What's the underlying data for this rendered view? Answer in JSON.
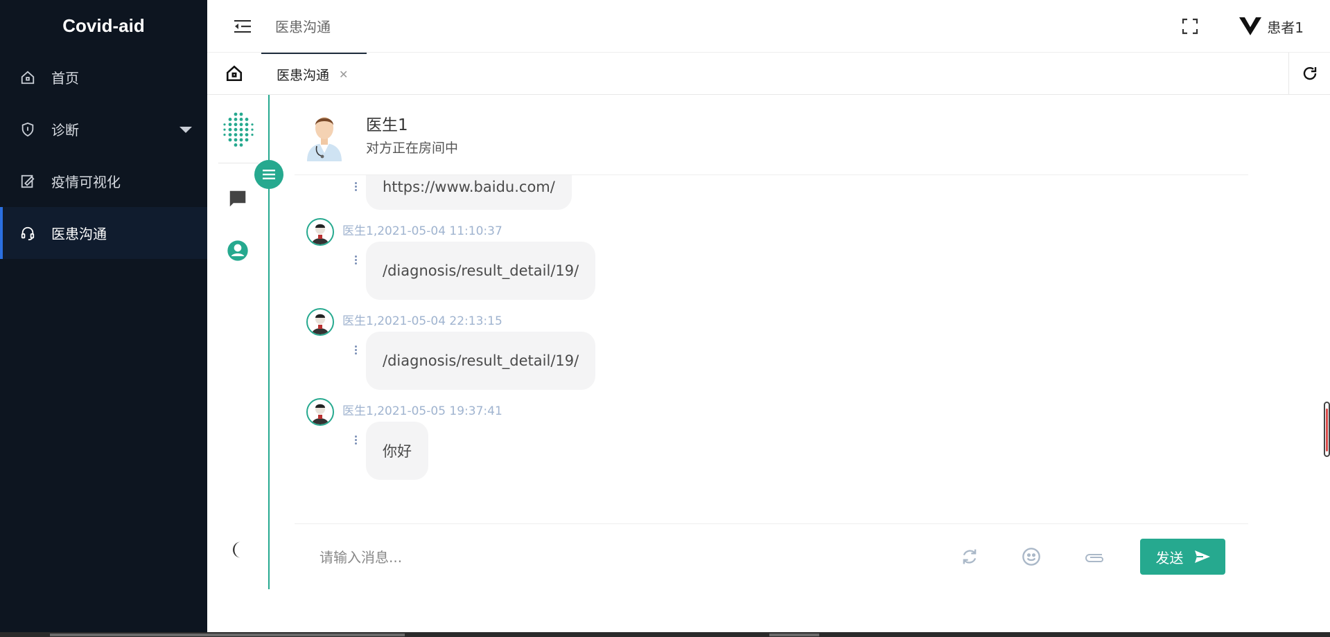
{
  "app": {
    "title": "Covid-aid"
  },
  "sidebar": {
    "items": [
      {
        "label": "首页",
        "icon": "home-icon",
        "active": false
      },
      {
        "label": "诊断",
        "icon": "shield-icon",
        "active": false,
        "has_submenu": true
      },
      {
        "label": "疫情可视化",
        "icon": "chart-edit-icon",
        "active": false
      },
      {
        "label": "医患沟通",
        "icon": "headset-icon",
        "active": true
      }
    ]
  },
  "header": {
    "breadcrumb": "医患沟通",
    "user_name": "患者1"
  },
  "tabs": {
    "items": [
      {
        "label": "医患沟通",
        "active": true,
        "closable": true
      }
    ]
  },
  "chat": {
    "peer": {
      "name": "医生1",
      "status": "对方正在房间中"
    },
    "messages": [
      {
        "meta": "",
        "text": "https://www.baidu.com/"
      },
      {
        "meta": "医生1,2021-05-04 11:10:37",
        "text": "/diagnosis/result_detail/19/"
      },
      {
        "meta": "医生1,2021-05-04 22:13:15",
        "text": "/diagnosis/result_detail/19/"
      },
      {
        "meta": "医生1,2021-05-05 19:37:41",
        "text": "你好"
      }
    ],
    "input": {
      "placeholder": "请输入消息...",
      "value": ""
    },
    "send_label": "发送"
  },
  "colors": {
    "sidebar_bg": "#0d1520",
    "accent": "#26a98f",
    "active_indicator": "#2b6fe0",
    "meta_text": "#9fb3cf",
    "bubble_bg": "#f4f4f5"
  }
}
